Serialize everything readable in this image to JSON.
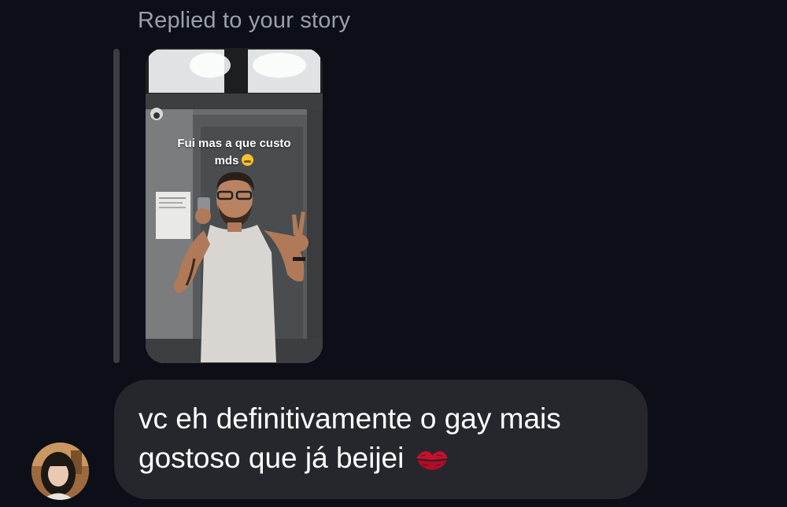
{
  "reply": {
    "header": "Replied to your story"
  },
  "story": {
    "caption_line1": "Fui mas a que custo",
    "caption_line2": "mds",
    "caption_emoji": "yawning-face-icon"
  },
  "message": {
    "line1": "vc eh definitivamente o gay mais",
    "line2": "gostoso que já beijei",
    "emoji": "kiss-mark-icon"
  },
  "colors": {
    "background": "#0c0f17",
    "bubble": "#25272d",
    "muted_text": "#9aa0aa",
    "reply_bar": "#3a3d44",
    "kiss": "#c8102e"
  }
}
